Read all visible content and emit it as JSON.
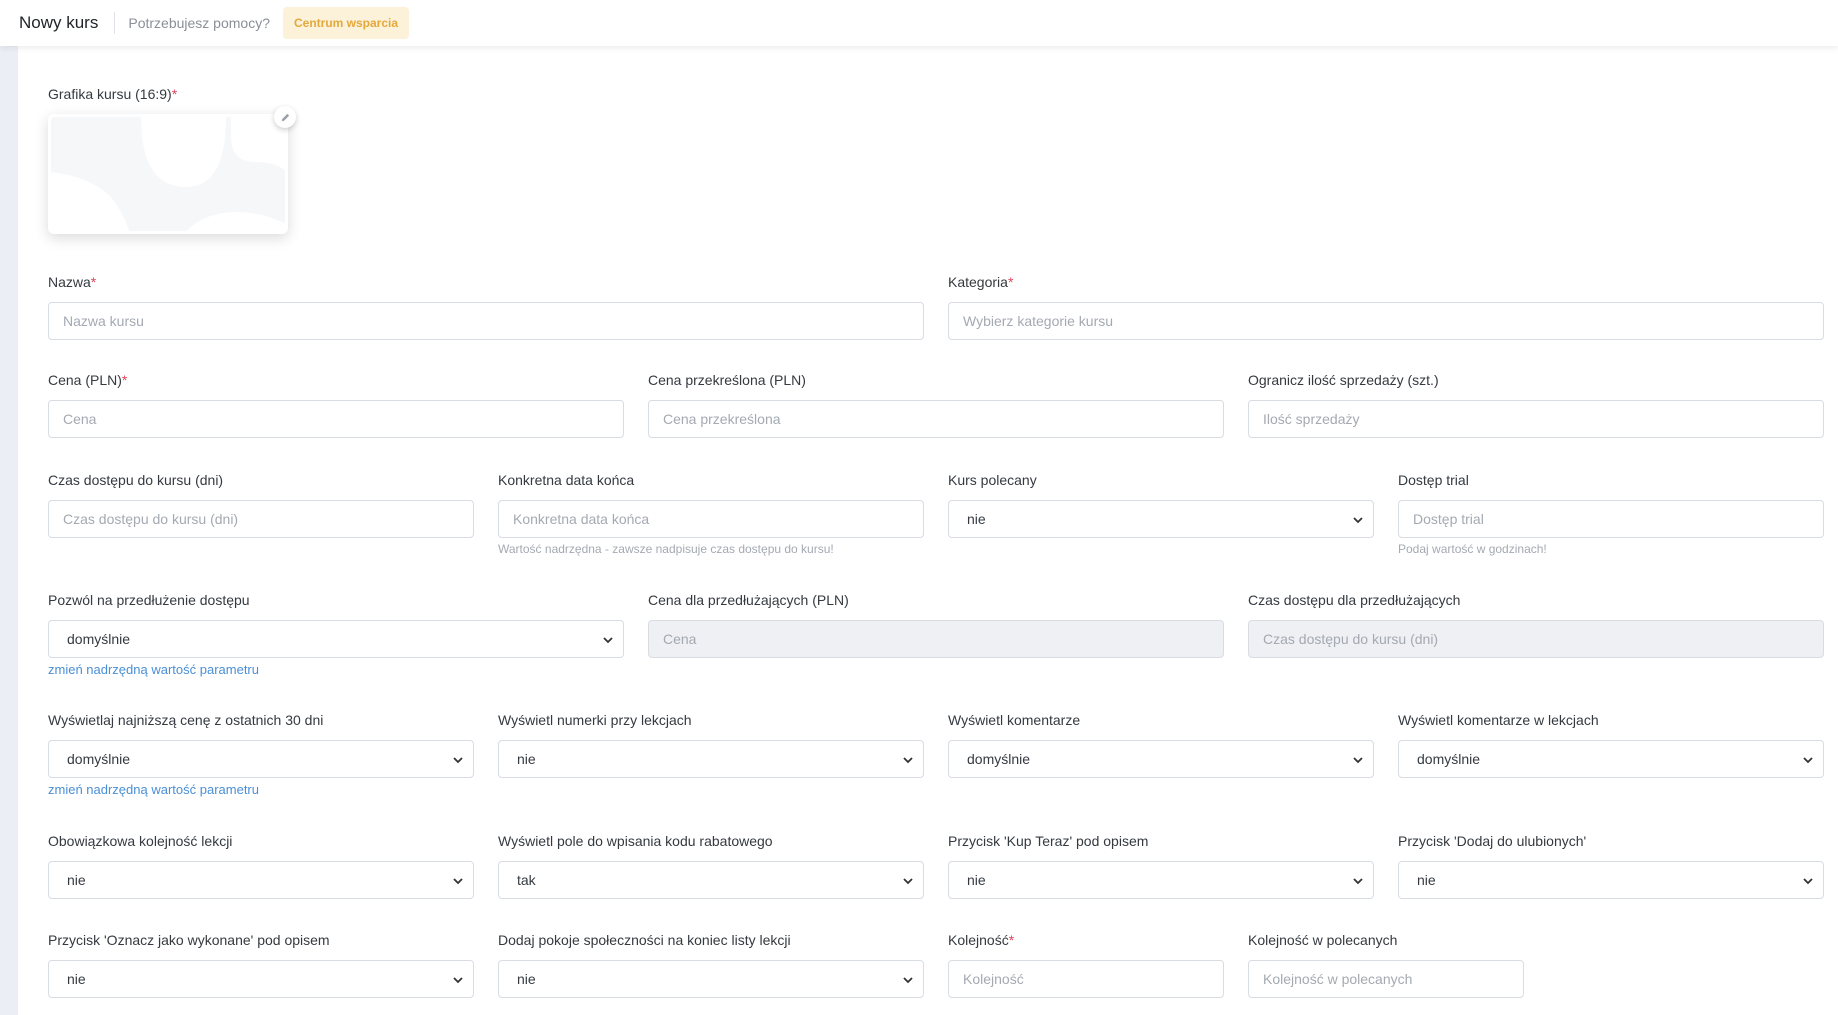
{
  "header": {
    "title": "Nowy kurs",
    "help_text": "Potrzebujesz pomocy?",
    "support_label": "Centrum wsparcia"
  },
  "image": {
    "label": "Grafika kursu (16:9)",
    "required": "*"
  },
  "fields": {
    "nazwa": {
      "label": "Nazwa",
      "required": "*",
      "placeholder": "Nazwa kursu"
    },
    "kategoria": {
      "label": "Kategoria",
      "required": "*",
      "placeholder": "Wybierz kategorie kursu"
    },
    "cena": {
      "label": "Cena (PLN)",
      "required": "*",
      "placeholder": "Cena"
    },
    "cena_przekreslona": {
      "label": "Cena przekreślona (PLN)",
      "placeholder": "Cena przekreślona"
    },
    "ogranicz": {
      "label": "Ogranicz ilość sprzedaży (szt.)",
      "placeholder": "Ilość sprzedaży"
    },
    "czas_dostepu": {
      "label": "Czas dostępu do kursu (dni)",
      "placeholder": "Czas dostępu do kursu (dni)"
    },
    "data_konca": {
      "label": "Konkretna data końca",
      "placeholder": "Konkretna data końca",
      "hint": "Wartość nadrzędna - zawsze nadpisuje czas dostępu do kursu!"
    },
    "kurs_polecany": {
      "label": "Kurs polecany",
      "value": "nie"
    },
    "dostep_trial": {
      "label": "Dostęp trial",
      "placeholder": "Dostęp trial",
      "hint": "Podaj wartość w godzinach!"
    },
    "przedluzenie": {
      "label": "Pozwól na przedłużenie dostępu",
      "value": "domyślnie",
      "link": "zmień nadrzędną wartość parametru"
    },
    "cena_przedluzajacych": {
      "label": "Cena dla przedłużających (PLN)",
      "placeholder": "Cena"
    },
    "czas_przedluzajacych": {
      "label": "Czas dostępu dla przedłużających",
      "placeholder": "Czas dostępu do kursu (dni)"
    },
    "najnizsza_cena": {
      "label": "Wyświetlaj najniższą cenę z ostatnich 30 dni",
      "value": "domyślnie",
      "link": "zmień nadrzędną wartość parametru"
    },
    "numerki": {
      "label": "Wyświetl numerki przy lekcjach",
      "value": "nie"
    },
    "komentarze": {
      "label": "Wyświetl komentarze",
      "value": "domyślnie"
    },
    "komentarze_lekcje": {
      "label": "Wyświetl komentarze w lekcjach",
      "value": "domyślnie"
    },
    "kolejnosc_lekcji": {
      "label": "Obowiązkowa kolejność lekcji",
      "value": "nie"
    },
    "kod_rabatowy": {
      "label": "Wyświetl pole do wpisania kodu rabatowego",
      "value": "tak"
    },
    "kup_teraz": {
      "label": "Przycisk 'Kup Teraz' pod opisem",
      "value": "nie"
    },
    "ulubione": {
      "label": "Przycisk 'Dodaj do ulubionych'",
      "value": "nie"
    },
    "wykonane": {
      "label": "Przycisk 'Oznacz jako wykonane' pod opisem",
      "value": "nie"
    },
    "pokoje": {
      "label": "Dodaj pokoje społeczności na koniec listy lekcji",
      "value": "nie"
    },
    "kolejnosc": {
      "label": "Kolejność",
      "required": "*",
      "placeholder": "Kolejność"
    },
    "kolejnosc_polecanych": {
      "label": "Kolejność w polecanych",
      "placeholder": "Kolejność w polecanych"
    }
  }
}
